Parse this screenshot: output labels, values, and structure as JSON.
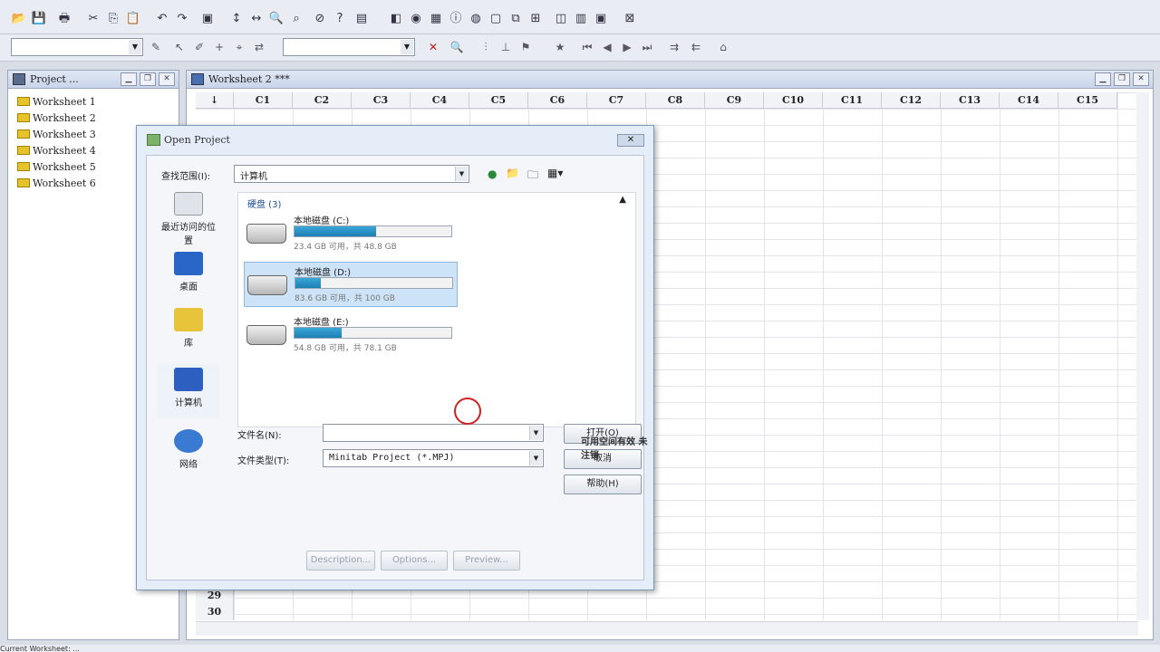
{
  "toolbar2": {
    "combo1_value": "",
    "combo2_value": ""
  },
  "project_panel": {
    "title": "Project ...",
    "items": [
      "Worksheet 1",
      "Worksheet 2",
      "Worksheet 3",
      "Worksheet 4",
      "Worksheet 5",
      "Worksheet 6"
    ]
  },
  "worksheet": {
    "title": "Worksheet 2 ***",
    "corner": "↓",
    "columns": [
      "C1",
      "C2",
      "C3",
      "C4",
      "C5",
      "C6",
      "C7",
      "C8",
      "C9",
      "C10",
      "C11",
      "C12",
      "C13",
      "C14",
      "C15"
    ],
    "visible_rows": [
      "29",
      "30"
    ]
  },
  "dialog": {
    "title": "Open Project",
    "lookin_label": "查找范围(I):",
    "lookin_value": "计算机",
    "section_header": "硬盘 (3)",
    "places": [
      "最近访问的位置",
      "桌面",
      "库",
      "计算机",
      "网络"
    ],
    "drives": [
      {
        "name": "本地磁盘 (C:)",
        "info": "23.4 GB 可用，共 48.8 GB",
        "used_fraction": 0.52
      },
      {
        "name": "本地磁盘 (D:)",
        "info": "83.6 GB 可用，共 100 GB",
        "used_fraction": 0.16
      },
      {
        "name": "本地磁盘 (E:)",
        "info": "54.8 GB 可用，共 78.1 GB",
        "used_fraction": 0.3
      }
    ],
    "tooltip": "可用空间有效 未注销",
    "filename_label": "文件名(N):",
    "filename_value": "",
    "filetype_label": "文件类型(T):",
    "filetype_value": "Minitab Project (*.MPJ)",
    "open_button": "打开(O)",
    "cancel_button": "取消",
    "help_button": "帮助(H)",
    "bottom_buttons": [
      "Description...",
      "Options...",
      "Preview..."
    ]
  },
  "statusbar": {
    "text": "Current Worksheet: ..."
  }
}
